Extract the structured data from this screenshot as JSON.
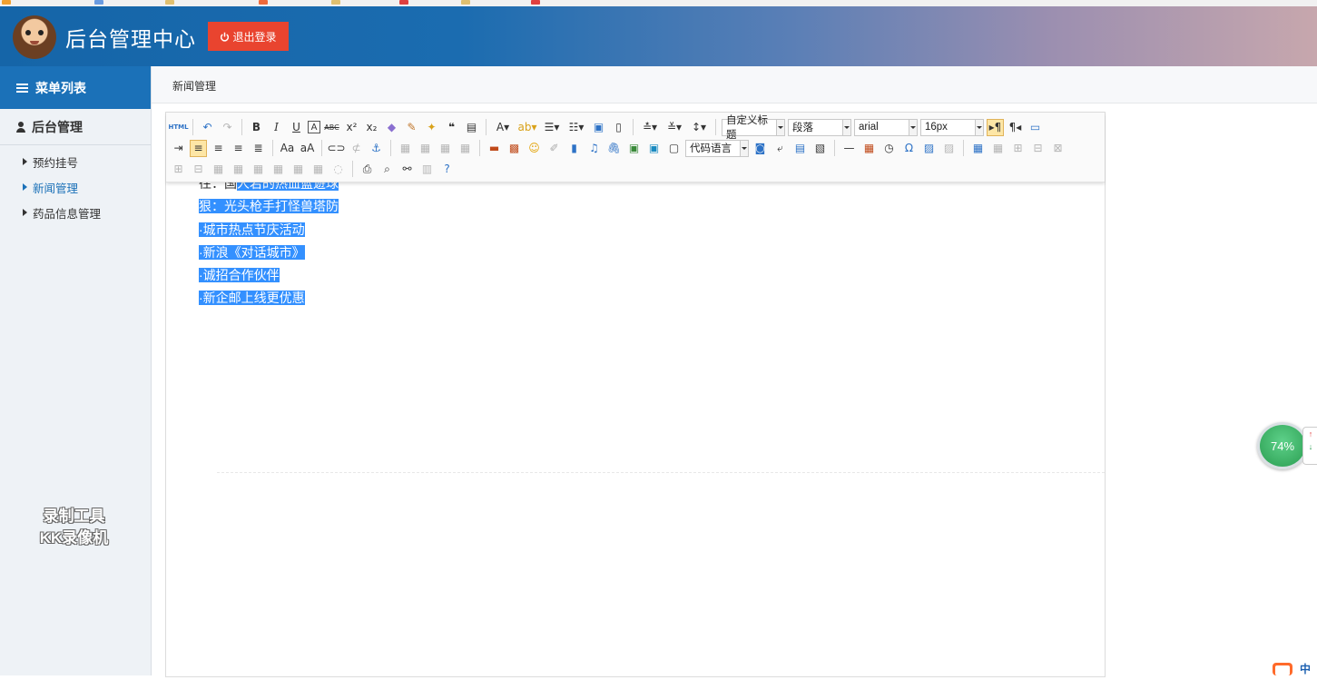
{
  "header": {
    "title": "后台管理中心",
    "logout_label": "退出登录",
    "logout_icon": "power-icon",
    "brand_color": "#1565a8",
    "logout_color": "#e9442f"
  },
  "sidebar": {
    "menu_title": "菜单列表",
    "section_title": "后台管理",
    "items": [
      {
        "label": "预约挂号",
        "active": false
      },
      {
        "label": "新闻管理",
        "active": true
      },
      {
        "label": "药品信息管理",
        "active": false
      }
    ],
    "watermark_line1": "录制工具",
    "watermark_line2": "KK录像机"
  },
  "content": {
    "breadcrumb": "新闻管理"
  },
  "editor": {
    "toolbar": {
      "html_label": "HTML",
      "custom_heading": "自定义标题",
      "paragraph": "段落",
      "font_family": "arial",
      "font_size": "16px",
      "code_language": "代码语言"
    },
    "lines": [
      {
        "prefix": "往：国",
        "selected": "人若的热血篮遊球"
      },
      {
        "prefix": "",
        "selected": "狠：光头枪手打怪兽塔防"
      },
      {
        "prefix": "",
        "selected": "·城市热点节庆活动"
      },
      {
        "prefix": "",
        "selected": "·新浪《对话城市》"
      },
      {
        "prefix": "",
        "selected": "·诚招合作伙伴"
      },
      {
        "prefix": "",
        "selected": "·新企邮上线更优惠"
      }
    ],
    "selection_color": "#3390ff"
  },
  "floating_badge": {
    "percent": "74%",
    "up_arrow": "↑",
    "down_arrow": "↓"
  },
  "corner_logo": "中"
}
